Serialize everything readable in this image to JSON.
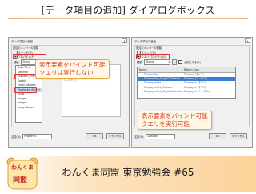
{
  "slide": {
    "title": "[データ項目の追加] ダイアログボックス",
    "footer": "わんくま同盟 東京勉強会 #65",
    "logo_line1": "わんくま",
    "logo_line2": "同盟",
    "accent_color": "#f2b27a"
  },
  "dialog_left": {
    "title": "データ項目の追加",
    "close": "x",
    "group_label": "追加のメンバーの種類",
    "radio_method": "メソッド(M)",
    "radio_property": "プロパティ(P)",
    "type_label": "種類:",
    "type_value": "String",
    "required_label": "必須にする(R)",
    "list_items": [
      "Date Time",
      "Decimal",
      "Division (Entry)",
      "Double",
      "Email Address",
      "Employee (Entry)",
      "GUID",
      "Image",
      "Integer",
      "Long Integer"
    ],
    "right_items": [
      "(ロンゲスト)",
      "(シンプル)",
      "(エンティ)",
      "(エンティ)"
    ],
    "name_label": "名前(N):",
    "name_value": "Property1",
    "ok": "OK",
    "cancel": "キャンセル",
    "callout_line1": "表示要素をバインド可能",
    "callout_line2": "クエリは実行しない"
  },
  "dialog_right": {
    "title": "データ項目の追加",
    "close": "x",
    "group_label": "追加のメンバーの種類",
    "radio_method": "メソッド(M)",
    "radio_property": "クエリ プロパティ(Q)",
    "type_label": "種類:",
    "type_value": "String",
    "required_label": "必須にする(R)",
    "grid_col_name": "Name",
    "grid_col_type": "Return Type",
    "grid_rows": [
      {
        "name": "DivisionSet",
        "type": "Division (すべて)"
      },
      {
        "name": "DivisionSet_SingleOrDefault",
        "type": "Division (シングル)"
      },
      {
        "name": "EmployeeSet",
        "type": "Employee (すべて)"
      },
      {
        "name": "EmployeeSet_Custom",
        "type": "Employee (すべて)"
      },
      {
        "name": "EmployeeSet_SingleOrDefault",
        "type": "Employee (シングル)"
      }
    ],
    "name_label": "名前(N):",
    "name_value": "Division",
    "ok": "OK",
    "cancel": "キャンセル",
    "callout_line1": "表示要素をバインド可能",
    "callout_line2": "クエリを実行可能"
  }
}
